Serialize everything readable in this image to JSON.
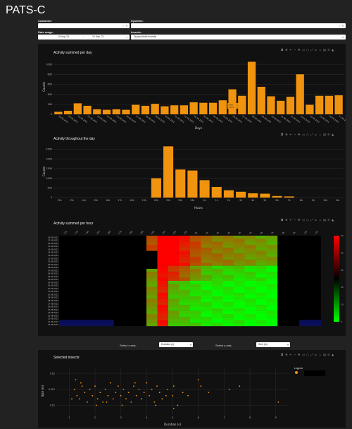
{
  "app": {
    "title": "PATS-C"
  },
  "filters": {
    "customer_label": "Customer:",
    "customer_value": "",
    "systems_label": "Systems:",
    "systems_value": "",
    "daterange_label": "Date range:",
    "date_start": "19 Aug '21",
    "date_arrow": "→",
    "date_end": "19 Sep '21",
    "insects_label": "Insects:",
    "insects_value": "Duponchelia fovealis"
  },
  "toolbar_icons": [
    "camera-icon",
    "zoom-icon",
    "plus-icon",
    "minus-icon",
    "pan-icon",
    "box-select-icon",
    "lasso-icon",
    "autoscale-icon",
    "reset-icon",
    "spike-icon",
    "hover-icon",
    "compare-icon",
    "logo-icon"
  ],
  "daily_chart": {
    "title": "Activity summed per day",
    "chart_data": {
      "type": "bar",
      "xlabel": "Days",
      "ylabel": "Counts",
      "ylim": [
        0,
        1100
      ],
      "yticks": [
        0,
        200,
        400,
        600,
        800,
        1000
      ],
      "bar_color": "#f0930e",
      "categories": [
        "19-08-2021",
        "20-08-2021",
        "21-08-2021",
        "22-08-2021",
        "23-08-2021",
        "24-08-2021",
        "25-08-2021",
        "26-08-2021",
        "27-08-2021",
        "28-08-2021",
        "29-08-2021",
        "30-08-2021",
        "31-08-2021",
        "01-09-2021",
        "02-09-2021",
        "03-09-2021",
        "04-09-2021",
        "05-09-2021",
        "06-09-2021",
        "07-09-2021",
        "08-09-2021",
        "09-09-2021",
        "10-09-2021",
        "11-09-2021",
        "12-09-2021",
        "13-09-2021",
        "14-09-2021",
        "15-09-2021",
        "16-09-2021",
        "17-09-2021"
      ],
      "values": [
        50,
        70,
        220,
        170,
        100,
        90,
        100,
        90,
        190,
        170,
        210,
        160,
        180,
        180,
        240,
        230,
        230,
        280,
        500,
        370,
        1050,
        550,
        360,
        270,
        350,
        800,
        190,
        370,
        370,
        380
      ],
      "hover_label": {
        "x": "Date",
        "y": "Count"
      }
    }
  },
  "hourly_chart": {
    "title": "Activity throughout the day",
    "chart_data": {
      "type": "bar",
      "xlabel": "Hours",
      "ylabel": "Counts",
      "ylim": [
        0,
        2700
      ],
      "yticks": [
        0,
        500,
        1000,
        1500,
        2000,
        2500
      ],
      "bar_color": "#f0930e",
      "categories": [
        "12h",
        "13h",
        "14h",
        "15h",
        "16h",
        "17h",
        "18h",
        "19h",
        "20h",
        "21h",
        "22h",
        "23h",
        "0h",
        "1h",
        "2h",
        "3h",
        "4h",
        "5h",
        "6h",
        "7h",
        "8h",
        "9h",
        "10h",
        "11h"
      ],
      "x_tick_labels": [
        "12h",
        "13h",
        "14h",
        "15h",
        "16h",
        "17h",
        "18h",
        "19h",
        "20h",
        "21h",
        "22h",
        "23h",
        "0h",
        "1h",
        "2h",
        "3h",
        "4h",
        "5h",
        "6h",
        "7h",
        "8h",
        "9h",
        "10h",
        "11h"
      ],
      "values": [
        0,
        0,
        0,
        0,
        0,
        0,
        0,
        0,
        1000,
        2650,
        1450,
        1400,
        900,
        550,
        380,
        300,
        220,
        200,
        80,
        60,
        0,
        0,
        0,
        0
      ]
    }
  },
  "heatmap_chart": {
    "title": "Activity summed per hour",
    "chart_data": {
      "type": "heatmap",
      "colorscale": [
        "#00ff00",
        "#000000",
        "#ff0000"
      ],
      "colorbar_ticks": [
        "0",
        "10",
        "20",
        "30",
        "40",
        "50"
      ],
      "columns": [
        "12h",
        "13h",
        "14h",
        "15h",
        "16h",
        "17h",
        "18h",
        "19h",
        "20h",
        "21h",
        "22h",
        "23h",
        "0h",
        "1h",
        "2h",
        "3h",
        "4h",
        "5h",
        "6h",
        "7h",
        "8h",
        "9h",
        "10h",
        "11h"
      ],
      "rows": [
        "18-09-2021",
        "17-09-2021",
        "16-09-2021",
        "15-09-2021",
        "14-09-2021",
        "13-09-2021",
        "12-09-2021",
        "11-09-2021",
        "10-09-2021",
        "09-09-2021",
        "08-09-2021",
        "07-09-2021",
        "06-09-2021",
        "05-09-2021",
        "04-09-2021",
        "03-09-2021",
        "02-09-2021",
        "01-09-2021",
        "31-08-2021",
        "30-08-2021",
        "29-08-2021",
        "28-08-2021",
        "27-08-2021",
        "26-08-2021",
        "25-08-2021",
        "24-08-2021",
        "23-08-2021",
        "22-08-2021",
        "21-08-2021",
        "20-08-2021"
      ]
    }
  },
  "axis_selectors": {
    "x_label": "Select x axis:",
    "x_value": "Duration (s)",
    "y_label": "Select y axis:",
    "y_value": "Size (m)"
  },
  "scatter_chart": {
    "title": "Selected insects:",
    "legend_title": "Legend",
    "chart_data": {
      "type": "scatter",
      "xlabel": "Duration (s)",
      "ylabel": "Size (m)",
      "xlim": [
        0.5,
        9.5
      ],
      "ylim": [
        0.007,
        0.022
      ],
      "xticks": [
        1,
        2,
        3,
        4,
        5,
        6,
        7,
        8,
        9
      ],
      "yticks": [
        0.01,
        0.015,
        0.02
      ],
      "point_color": "#f0930e",
      "points": [
        [
          1.2,
          0.015
        ],
        [
          1.3,
          0.013
        ],
        [
          1.5,
          0.016
        ],
        [
          1.4,
          0.012
        ],
        [
          1.6,
          0.014
        ],
        [
          1.7,
          0.011
        ],
        [
          1.8,
          0.015
        ],
        [
          1.9,
          0.013
        ],
        [
          2.0,
          0.016
        ],
        [
          2.1,
          0.012
        ],
        [
          2.2,
          0.014
        ],
        [
          2.3,
          0.011
        ],
        [
          2.4,
          0.015
        ],
        [
          2.5,
          0.013
        ],
        [
          2.6,
          0.017
        ],
        [
          2.7,
          0.012
        ],
        [
          2.8,
          0.014
        ],
        [
          2.9,
          0.016
        ],
        [
          3.0,
          0.013
        ],
        [
          3.1,
          0.015
        ],
        [
          3.2,
          0.012
        ],
        [
          3.3,
          0.014
        ],
        [
          3.4,
          0.011
        ],
        [
          3.5,
          0.016
        ],
        [
          3.6,
          0.013
        ],
        [
          3.7,
          0.015
        ],
        [
          3.8,
          0.012
        ],
        [
          3.9,
          0.014
        ],
        [
          4.0,
          0.017
        ],
        [
          4.1,
          0.013
        ],
        [
          4.2,
          0.015
        ],
        [
          4.3,
          0.011
        ],
        [
          4.4,
          0.016
        ],
        [
          4.5,
          0.014
        ],
        [
          4.6,
          0.012
        ],
        [
          4.8,
          0.015
        ],
        [
          5.0,
          0.013
        ],
        [
          5.2,
          0.01
        ],
        [
          5.4,
          0.014
        ],
        [
          5.6,
          0.013
        ],
        [
          6.0,
          0.018
        ],
        [
          6.1,
          0.016
        ],
        [
          6.4,
          0.014
        ],
        [
          7.2,
          0.015
        ],
        [
          7.6,
          0.016
        ],
        [
          9.1,
          0.011
        ],
        [
          1.1,
          0.012
        ],
        [
          1.45,
          0.017
        ],
        [
          2.05,
          0.01
        ],
        [
          2.45,
          0.011
        ],
        [
          3.05,
          0.01
        ],
        [
          3.55,
          0.017
        ],
        [
          4.35,
          0.01
        ],
        [
          4.75,
          0.013
        ],
        [
          5.05,
          0.016
        ],
        [
          5.05,
          0.009
        ],
        [
          1.25,
          0.018
        ]
      ]
    }
  }
}
